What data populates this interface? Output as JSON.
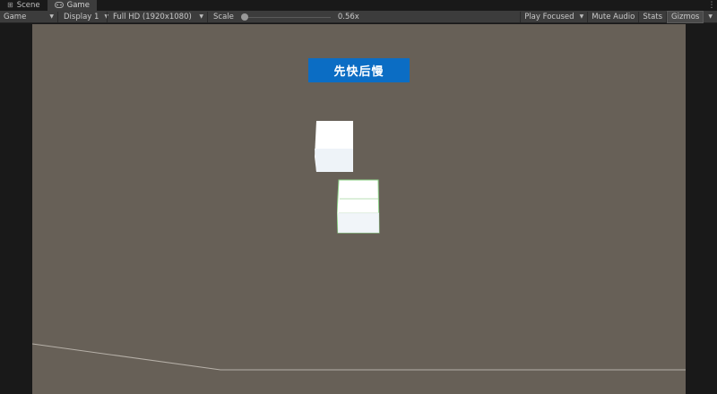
{
  "tabs": [
    {
      "label": "Scene",
      "icon": "grid-icon",
      "active": false
    },
    {
      "label": "Game",
      "icon": "gamepad-icon",
      "active": true
    }
  ],
  "toolbar": {
    "view_mode": "Game",
    "display": "Display 1",
    "resolution": "Full HD (1920x1080)",
    "scale_label": "Scale",
    "scale_value": "0.56x",
    "scale_position": 0.0,
    "play_mode": "Play Focused",
    "mute_label": "Mute Audio",
    "stats_label": "Stats",
    "gizmos_label": "Gizmos"
  },
  "game": {
    "button_label": "先快后慢",
    "button_color": "#0b6dc4",
    "background_color": "#676057",
    "cubes": [
      {
        "name": "white cube",
        "color": "#ffffff"
      },
      {
        "name": "selected cube",
        "color": "#ffffff",
        "outline": "#8fd48a"
      }
    ]
  }
}
